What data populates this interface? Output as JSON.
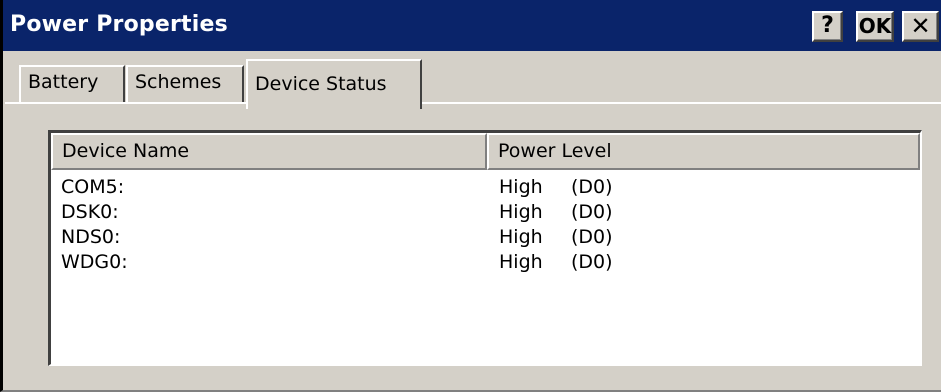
{
  "window": {
    "title": "Power Properties",
    "help_label": "?",
    "ok_label": "OK",
    "close_label": "✕"
  },
  "tabs": [
    {
      "label": "Battery",
      "selected": false
    },
    {
      "label": "Schemes",
      "selected": false
    },
    {
      "label": "Device Status",
      "selected": true
    }
  ],
  "device_list": {
    "columns": [
      "Device Name",
      "Power Level"
    ],
    "rows": [
      {
        "name": "COM5:",
        "level": "High",
        "state": "(D0)"
      },
      {
        "name": "DSK0:",
        "level": "High",
        "state": "(D0)"
      },
      {
        "name": "NDS0:",
        "level": "High",
        "state": "(D0)"
      },
      {
        "name": "WDG0:",
        "level": "High",
        "state": "(D0)"
      }
    ]
  },
  "colors": {
    "titlebar": "#0a246a",
    "face": "#d4d0c8",
    "list_bg": "#ffffff"
  },
  "icons": {
    "help": "question-mark",
    "close": "x-mark"
  }
}
